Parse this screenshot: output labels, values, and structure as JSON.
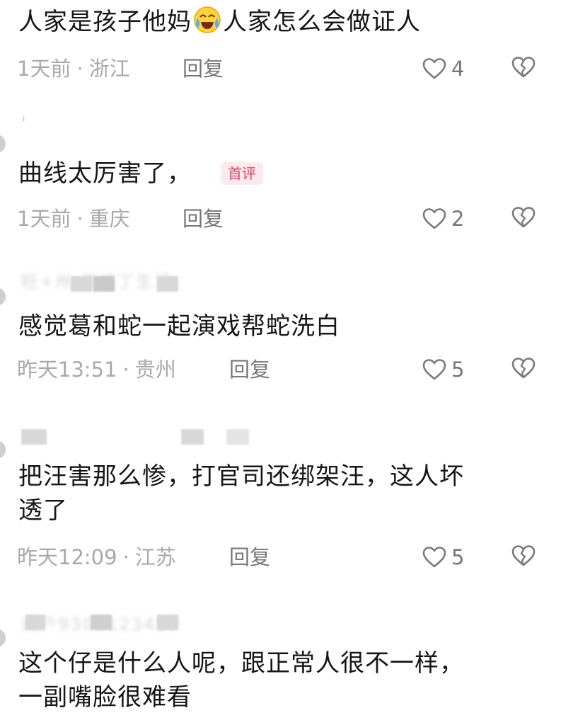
{
  "comments": [
    {
      "text_before_emoji": "人家是孩子他妈",
      "emoji": "crying-laughing-face",
      "text_after_emoji": "人家怎么会做证人",
      "time": "1天前",
      "location": "浙江",
      "reply_label": "回复",
      "likes": "4"
    },
    {
      "username": "'",
      "text": "曲线太厉害了，",
      "badge": "首评",
      "time": "1天前",
      "location": "重庆",
      "reply_label": "回复",
      "likes": "2"
    },
    {
      "username": "旺+卅·库纯丁生活",
      "text": "感觉葛和蛇一起演戏帮蛇洗白",
      "time": "昨天13:51",
      "location": "贵州",
      "reply_label": "回复",
      "likes": "5"
    },
    {
      "username": "",
      "text_line1": "把汪害那么惨，打官司还绑架汪，这人坏",
      "text_line2": "透了",
      "time": "昨天12:09",
      "location": "江苏",
      "reply_label": "回复",
      "likes": "5"
    },
    {
      "username": "用户9300123489",
      "text_line1": "这个仔是什么人呢，跟正常人很不一样，",
      "text_line2": "一副嘴脸很难看"
    }
  ],
  "colors": {
    "text": "#161616",
    "meta": "#a9a9a9",
    "action": "#767676",
    "badge_bg": "#fbeaee",
    "badge_text": "#e2405f"
  },
  "icons": {
    "like": "heart-outline-icon",
    "dislike": "broken-heart-icon",
    "emoji": "crying-laughing-emoji-icon"
  },
  "separator": "·"
}
